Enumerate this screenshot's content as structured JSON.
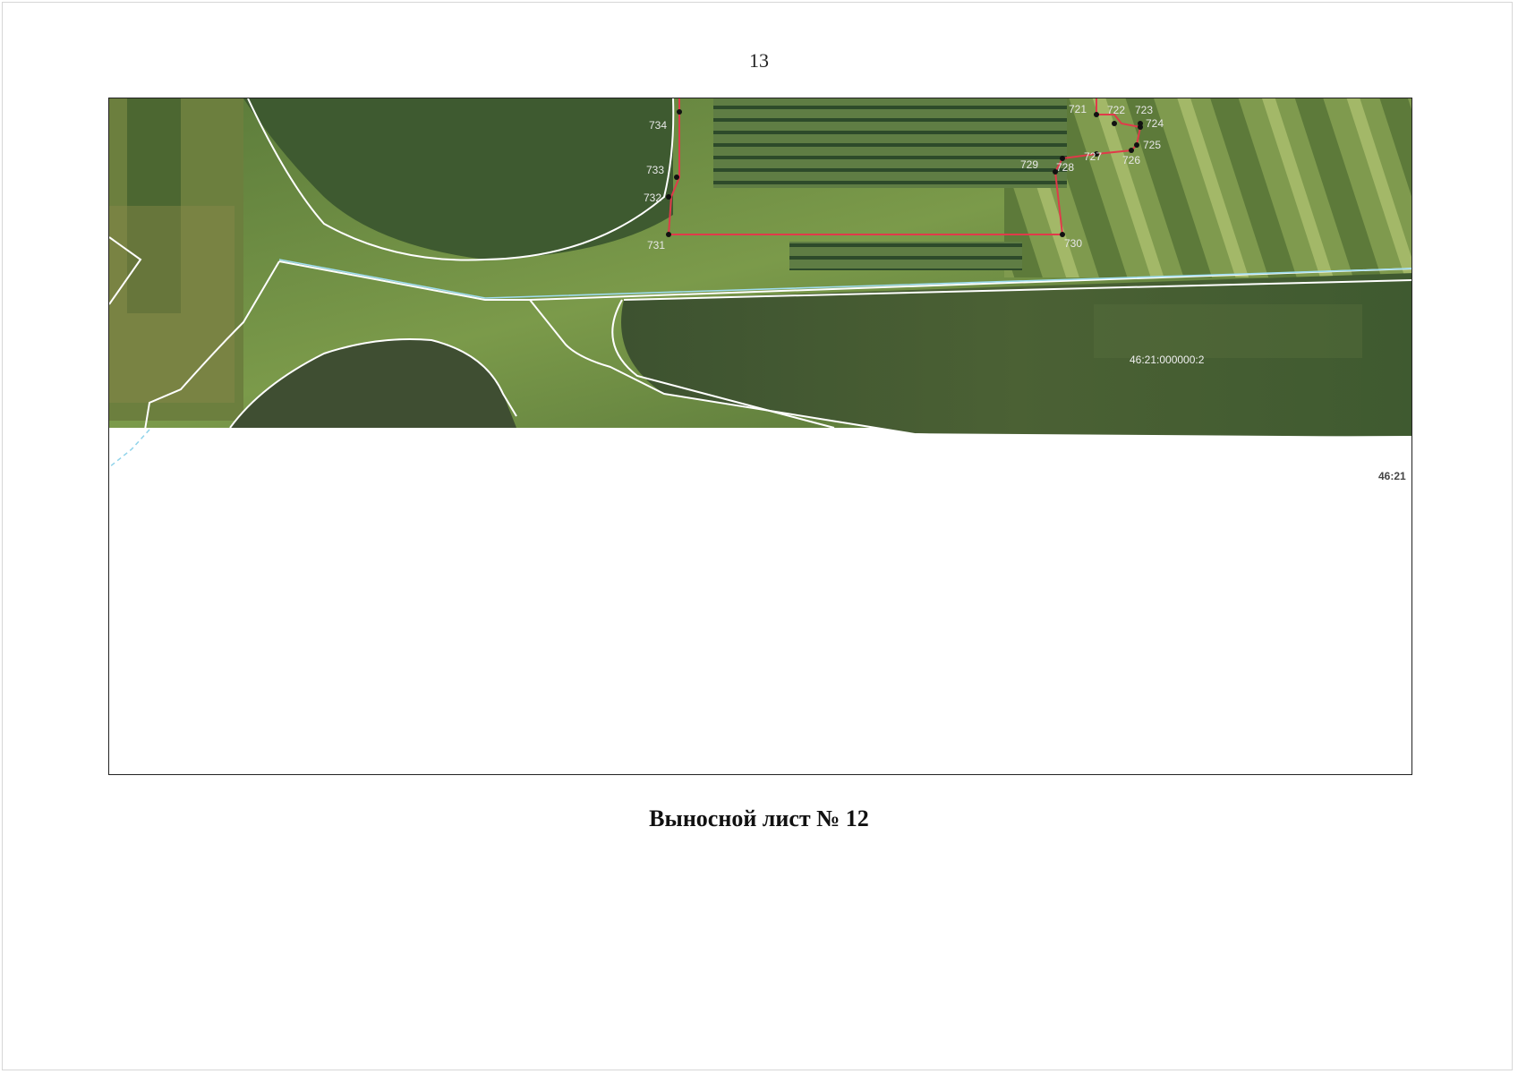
{
  "page_number": "13",
  "caption": "Выносной лист № 12",
  "map": {
    "colors": {
      "boundary": "#e03a4a",
      "cadastral_lines": "#ffffff",
      "road_line": "#9fdcef",
      "water_dashed": "#8fd3ea"
    },
    "parcel_label": "46:21:000000:2",
    "block_label": "46:21",
    "points": [
      {
        "id": "721",
        "label": "721"
      },
      {
        "id": "722",
        "label": "722"
      },
      {
        "id": "723",
        "label": "723"
      },
      {
        "id": "724",
        "label": "724"
      },
      {
        "id": "725",
        "label": "725"
      },
      {
        "id": "726",
        "label": "726"
      },
      {
        "id": "727",
        "label": "727"
      },
      {
        "id": "728",
        "label": "728"
      },
      {
        "id": "729",
        "label": "729"
      },
      {
        "id": "730",
        "label": "730"
      },
      {
        "id": "731",
        "label": "731"
      },
      {
        "id": "732",
        "label": "732"
      },
      {
        "id": "733",
        "label": "733"
      },
      {
        "id": "734",
        "label": "734"
      }
    ]
  }
}
